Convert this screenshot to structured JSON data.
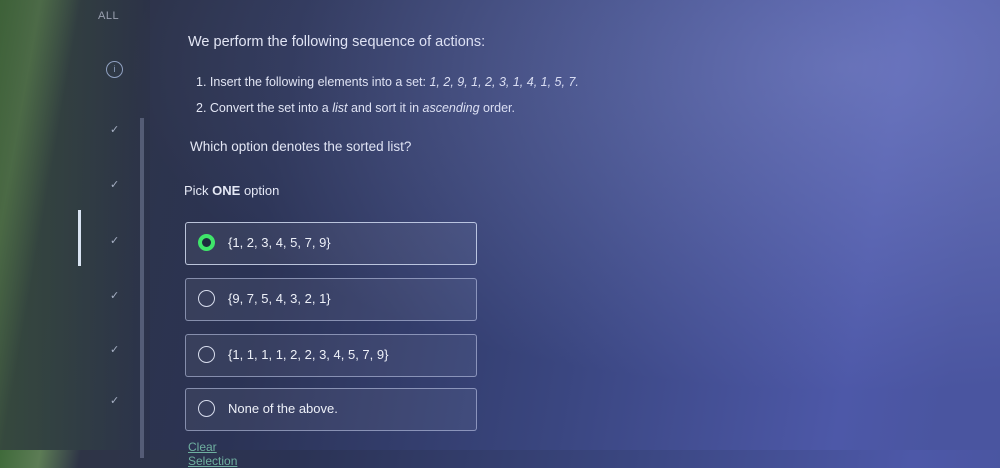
{
  "sidebar": {
    "all_label": "ALL",
    "info_icon": "i",
    "check_icon": "✓"
  },
  "question": {
    "intro": "We perform the following sequence of actions:",
    "step1_prefix": "1. Insert the following elements into a set: ",
    "step1_set": "1, 2, 9, 1, 2, 3, 1, 4, 1, 5, 7.",
    "step2_a": "2. Convert the set into a ",
    "step2_list": "list",
    "step2_b": " and sort it in ",
    "step2_asc": "ascending",
    "step2_c": " order.",
    "prompt": "Which option denotes the sorted list?"
  },
  "pick": {
    "prefix": "Pick ",
    "bold": "ONE",
    "suffix": " option"
  },
  "options": [
    {
      "label": "{1, 2, 3, 4, 5, 7, 9}",
      "selected": true
    },
    {
      "label": "{9, 7, 5, 4, 3, 2, 1}",
      "selected": false
    },
    {
      "label": "{1, 1, 1, 1, 2, 2, 3, 4, 5, 7, 9}",
      "selected": false
    },
    {
      "label": "None of the above.",
      "selected": false
    }
  ],
  "clear_label": "Clear Selection",
  "colors": {
    "selected_radio": "#3fe56a",
    "text": "#e6e9f5"
  }
}
